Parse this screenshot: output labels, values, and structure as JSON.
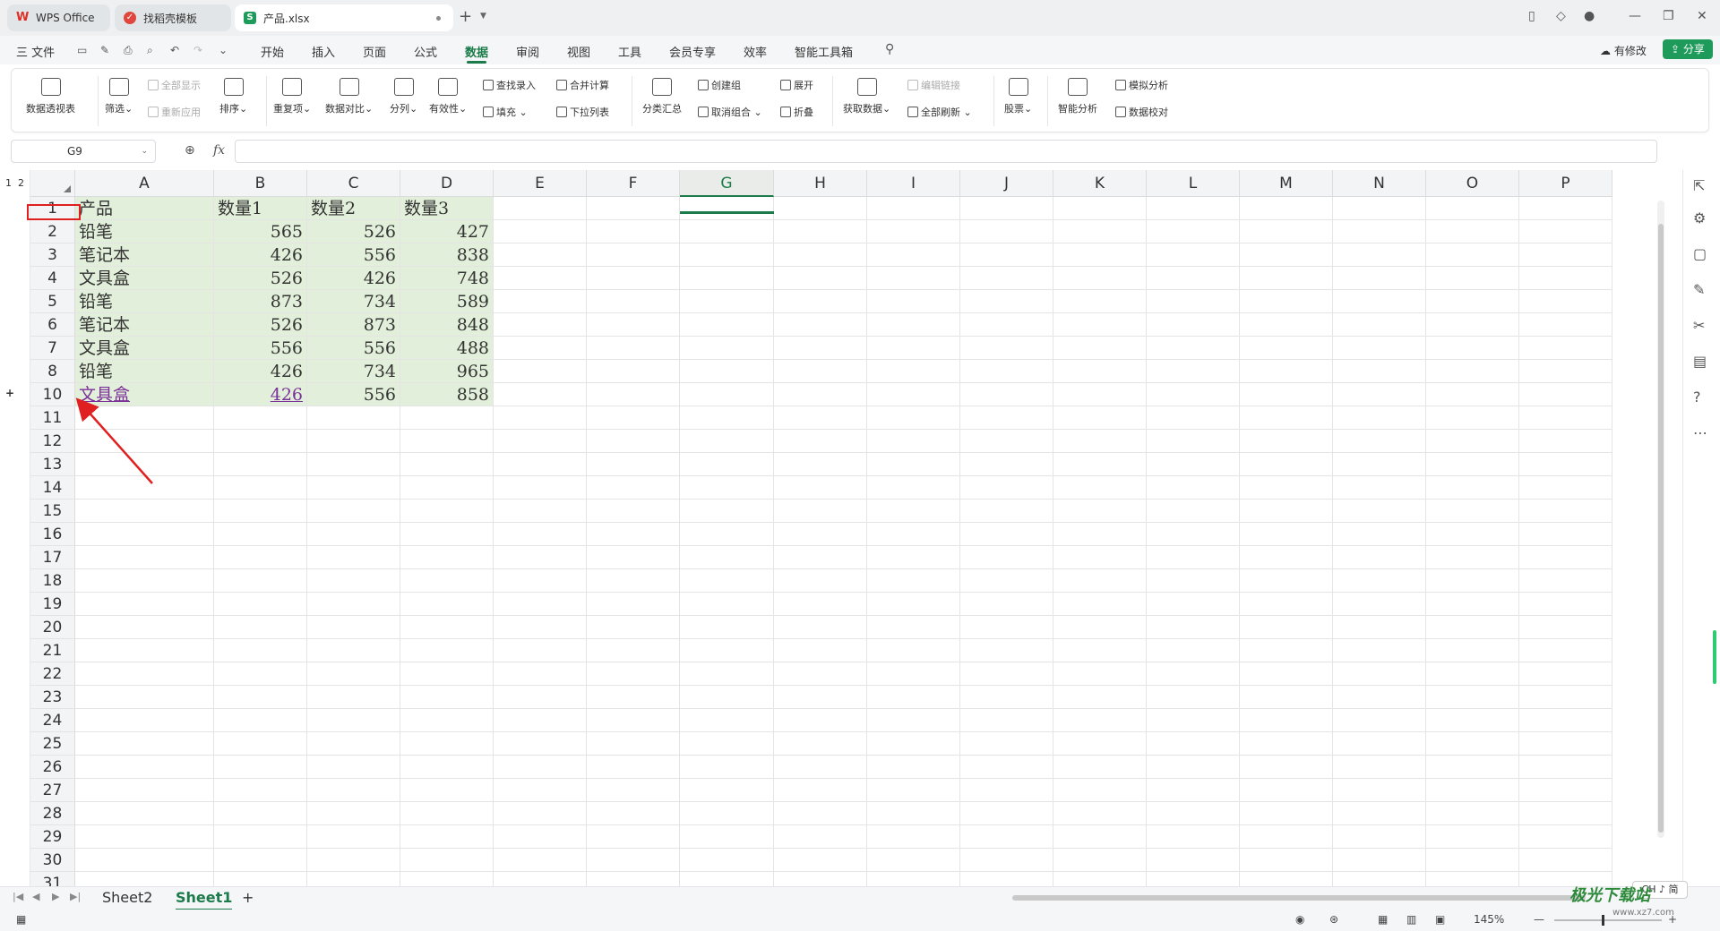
{
  "titlebar": {
    "tabs": [
      {
        "label": "WPS Office"
      },
      {
        "label": "找稻壳模板"
      },
      {
        "label": "产品.xlsx"
      }
    ]
  },
  "menu": {
    "file": "三 文件",
    "items": [
      "开始",
      "插入",
      "页面",
      "公式",
      "数据",
      "审阅",
      "视图",
      "工具",
      "会员专享",
      "效率",
      "智能工具箱"
    ],
    "active": "数据",
    "modified": "有修改",
    "share": "分享"
  },
  "ribbon": {
    "pivot": "数据透视表",
    "filter": "筛选",
    "show_all": "全部显示",
    "reapply": "重新应用",
    "sort": "排序",
    "duplicates": "重复项",
    "compare": "数据对比",
    "split": "分列",
    "validity": "有效性",
    "lookup": "查找录入",
    "fill": "填充",
    "consolidate": "合并计算",
    "dropdown": "下拉列表",
    "subtotal": "分类汇总",
    "group": "创建组",
    "ungroup": "取消组合",
    "expand": "展开",
    "collapse": "折叠",
    "get_data": "获取数据",
    "edit_links": "编辑链接",
    "refresh_all": "全部刷新",
    "stocks": "股票",
    "smart_analysis": "智能分析",
    "what_if": "模拟分析",
    "data_check": "数据校对"
  },
  "formula_bar": {
    "name_box": "G9",
    "fx": "fx",
    "value": ""
  },
  "grid": {
    "outline_levels": [
      "1",
      "2"
    ],
    "columns": [
      "A",
      "B",
      "C",
      "D",
      "E",
      "F",
      "G",
      "H",
      "I",
      "J",
      "K",
      "L",
      "M",
      "N",
      "O",
      "P"
    ],
    "selected_column": "G",
    "row_numbers": [
      "1",
      "2",
      "3",
      "4",
      "5",
      "6",
      "7",
      "8",
      "10",
      "11",
      "12",
      "13",
      "14",
      "15",
      "16",
      "17",
      "18",
      "19",
      "20",
      "21",
      "22",
      "23",
      "24",
      "25",
      "26",
      "27",
      "28",
      "29",
      "30",
      "31"
    ],
    "rows": [
      [
        "产品",
        "数量1",
        "数量2",
        "数量3"
      ],
      [
        "铅笔",
        "565",
        "526",
        "427"
      ],
      [
        "笔记本",
        "426",
        "556",
        "838"
      ],
      [
        "文具盒",
        "526",
        "426",
        "748"
      ],
      [
        "铅笔",
        "873",
        "734",
        "589"
      ],
      [
        "笔记本",
        "526",
        "873",
        "848"
      ],
      [
        "文具盒",
        "556",
        "556",
        "488"
      ],
      [
        "铅笔",
        "426",
        "734",
        "965"
      ],
      [
        "文具盒",
        "426",
        "556",
        "858"
      ]
    ]
  },
  "sheets": {
    "tabs": [
      "Sheet2",
      "Sheet1"
    ],
    "active": "Sheet1"
  },
  "ime": "CH ♪ 简",
  "status": {
    "zoom": "145%"
  },
  "watermark": {
    "text": "极光下载站",
    "url": "www.xz7.com"
  },
  "colors": {
    "accent": "#1c7b4a",
    "data_fill": "#e2efda",
    "highlight_red": "#e02020",
    "link": "#7b2f98"
  }
}
